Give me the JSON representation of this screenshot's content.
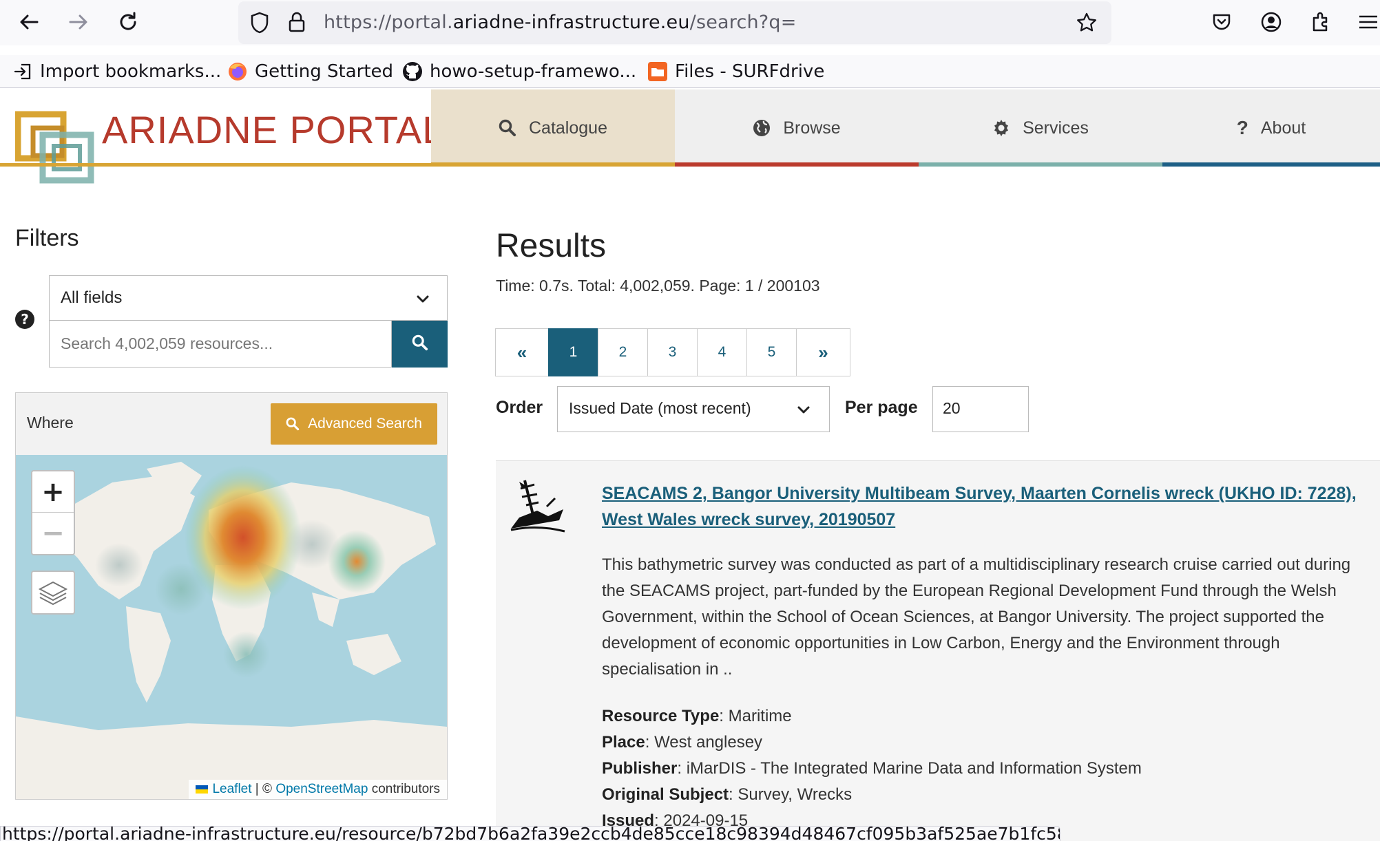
{
  "browser": {
    "url_prefix": "https://portal.",
    "url_host": "ariadne-infrastructure.eu",
    "url_path": "/search?q=",
    "bookmarks": [
      {
        "label": "Import bookmarks...",
        "icon": "import-icon"
      },
      {
        "label": "Getting Started",
        "icon": "firefox-icon"
      },
      {
        "label": "howo-setup-framewo...",
        "icon": "github-icon"
      },
      {
        "label": "Files - SURFdrive",
        "icon": "surfdrive-icon"
      }
    ],
    "status_url": "https://portal.ariadne-infrastructure.eu/resource/b72bd7b6a2fa39e2ccb4de85cce18c98394d48467cf095b3af525ae7b1fc5845"
  },
  "site": {
    "logo_text": "ARIADNE PORTAL",
    "nav": [
      {
        "label": "Catalogue",
        "icon": "search-icon",
        "color": "#d8a433"
      },
      {
        "label": "Browse",
        "icon": "globe-icon",
        "color": "#bb3a2c"
      },
      {
        "label": "Services",
        "icon": "gear-icon",
        "color": "#7bb0aa"
      },
      {
        "label": "About",
        "icon": "question-icon",
        "color": "#1d5f86"
      }
    ]
  },
  "filters": {
    "title": "Filters",
    "field_select": "All fields",
    "search_placeholder": "Search 4,002,059 resources...",
    "where_label": "Where",
    "advanced_search": "Advanced Search",
    "zoom_in": "+",
    "zoom_out": "−",
    "attribution_leaflet": "Leaflet",
    "attribution_sep": " | © ",
    "attribution_osm": "OpenStreetMap",
    "attribution_tail": " contributors"
  },
  "results": {
    "title": "Results",
    "meta": "Time: 0.7s. Total: 4,002,059. Page: 1 / 200103",
    "pager": [
      "«",
      "1",
      "2",
      "3",
      "4",
      "5",
      "»"
    ],
    "order_label": "Order",
    "order_value": "Issued Date (most recent)",
    "perpage_label": "Per page",
    "perpage_value": "20",
    "items": [
      {
        "icon": "shipwreck-icon",
        "title": "SEACAMS 2, Bangor University Multibeam Survey, Maarten Cornelis wreck (UKHO ID: 7228), West Wales wreck survey, 20190507",
        "description": "This bathymetric survey was conducted as part of a multidisciplinary research cruise carried out during the SEACAMS project, part-funded by the European Regional Development Fund through the Welsh Government, within the School of Ocean Sciences, at Bangor University. The project supported the development of economic opportunities in Low Carbon, Energy and the Environment through specialisation in ..",
        "resource_type_label": "Resource Type",
        "resource_type": "Maritime",
        "place_label": "Place",
        "place": "West anglesey",
        "publisher_label": "Publisher",
        "publisher": "iMarDIS - The Integrated Marine Data and Information System",
        "subject_label": "Original Subject",
        "subject": "Survey, Wrecks",
        "issued_label": "Issued",
        "issued": "2024-09-15"
      }
    ]
  }
}
